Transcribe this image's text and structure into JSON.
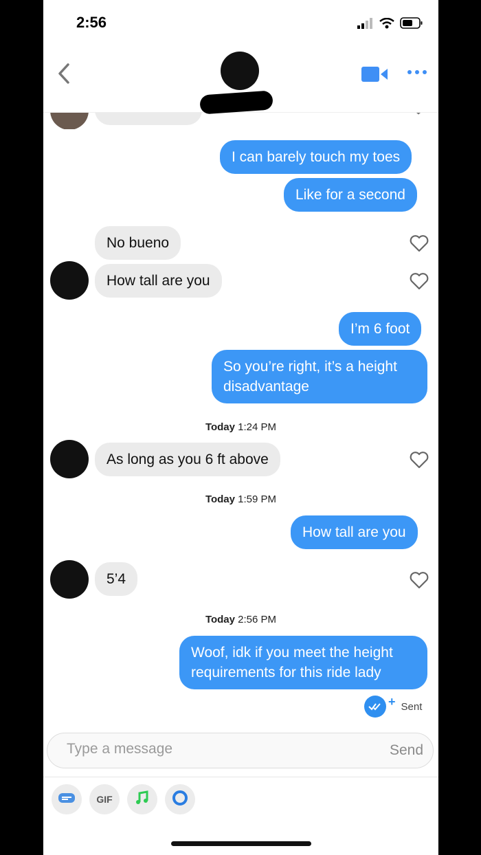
{
  "status": {
    "time": "2:56"
  },
  "conversation": [
    {
      "id": "m1",
      "dir": "out",
      "text": "I can barely touch my toes"
    },
    {
      "id": "m2",
      "dir": "out",
      "text": "Like for a second"
    },
    {
      "id": "m3",
      "dir": "in",
      "text": "No bueno"
    },
    {
      "id": "m4",
      "dir": "in",
      "text": "How tall are you"
    },
    {
      "id": "m5",
      "dir": "out",
      "text": "I’m 6 foot"
    },
    {
      "id": "m6a",
      "dir": "out",
      "text": "So you’re right, it’s a height"
    },
    {
      "id": "m6b",
      "dir": "out",
      "text": "disadvantage"
    },
    {
      "id": "m7",
      "dir": "in",
      "text": "As long as you 6 ft above"
    },
    {
      "id": "m8",
      "dir": "out",
      "text": "How tall are you"
    },
    {
      "id": "m9",
      "dir": "in",
      "text": "5’4"
    },
    {
      "id": "m10a",
      "dir": "out",
      "text": "Woof, idk if you meet the height"
    },
    {
      "id": "m10b",
      "dir": "out",
      "text": "requirements for this ride lady"
    }
  ],
  "timestamps": [
    {
      "day": "Today",
      "time": "1:24 PM"
    },
    {
      "day": "Today",
      "time": "1:59 PM"
    },
    {
      "day": "Today",
      "time": "2:56 PM"
    }
  ],
  "sent_label": "Sent",
  "composer": {
    "placeholder": "Type a message",
    "send_label": "Send"
  },
  "toolbar": {
    "gif_label": "GIF"
  },
  "colors": {
    "outgoing": "#3c97f6",
    "incoming": "#ebebeb",
    "accent": "#3f8ff5",
    "music": "#2ecb53"
  }
}
